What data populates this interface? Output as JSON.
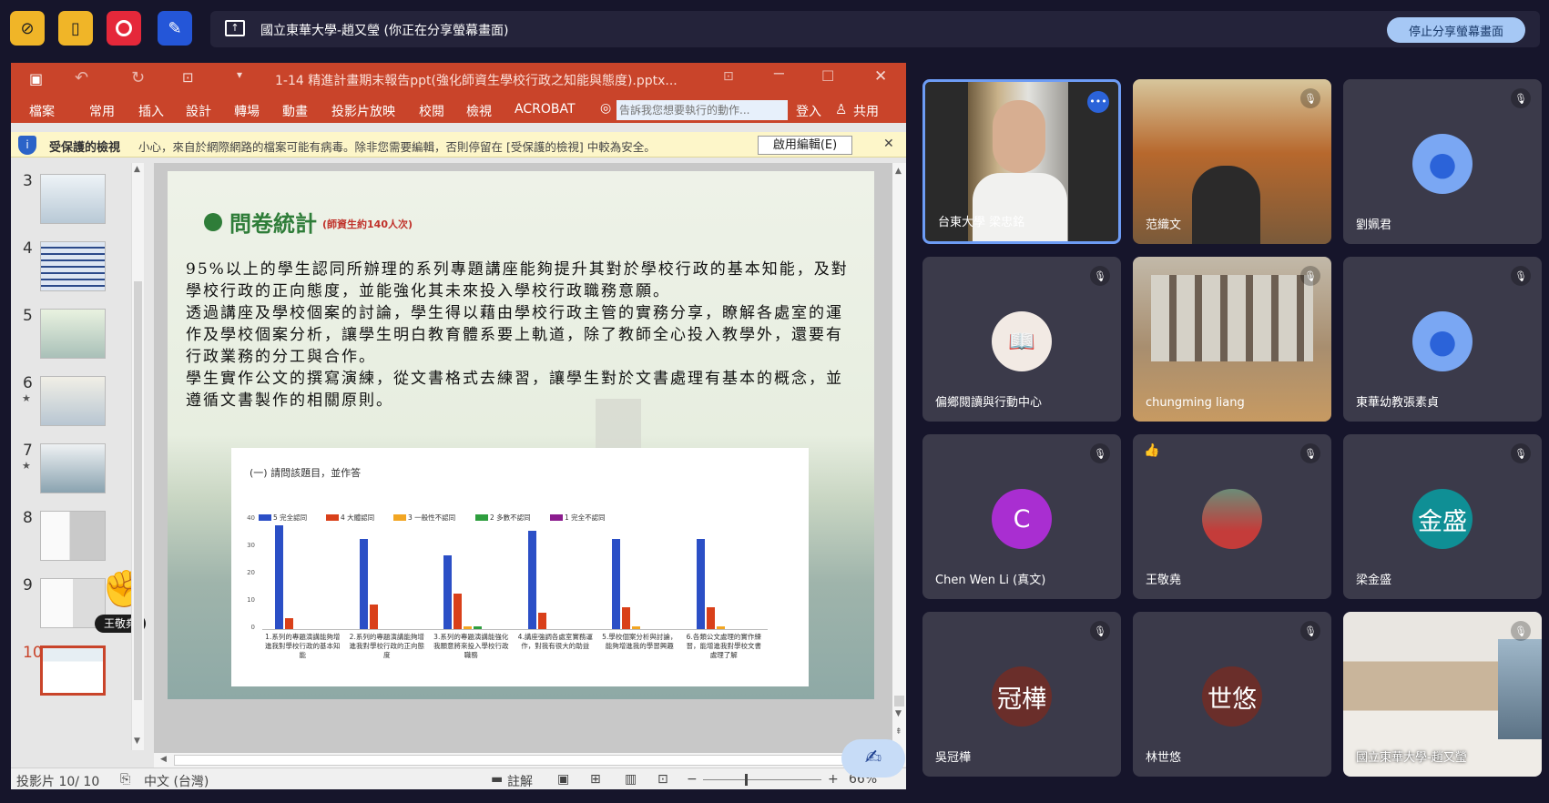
{
  "topbar": {
    "share_title": "國立東華大學-趙又瑩 (你正在分享螢幕畫面)",
    "stop_label": "停止分享螢幕畫面"
  },
  "colors": {
    "accent": "#2b63d9",
    "ppt_red": "#c9442a",
    "warn_bg": "#fdf6c9",
    "tile_bg": "#3b3a4a"
  },
  "ppt": {
    "filename": "1-14 精進計畫期末報告ppt(強化師資生學校行政之知能與態度).pptx...",
    "tabs": [
      "檔案",
      "常用",
      "插入",
      "設計",
      "轉場",
      "動畫",
      "投影片放映",
      "校閱",
      "檢視",
      "ACROBAT"
    ],
    "search_placeholder": "告訴我您想要執行的動作...",
    "login": "登入",
    "share": "共用",
    "warning_title": "受保護的檢視",
    "warning_text": "小心，來自於網際網路的檔案可能有病毒。除非您需要編輯，否則停留在 [受保護的檢視] 中較為安全。",
    "enable_edit": "啟用編輯(E)",
    "thumb_numbers": [
      "3",
      "4",
      "5",
      "6",
      "7",
      "8",
      "9",
      "10"
    ],
    "hand_label": "王敬堯",
    "status": {
      "slide": "投影片 10/ 10",
      "lang": "中文 (台灣)",
      "notes": "註解",
      "zoom": "66%"
    }
  },
  "slide": {
    "title": "問卷統計",
    "title_sub": "(師資生約140人次)",
    "paragraphs": [
      "95%以上的學生認同所辦理的系列專題講座能夠提升其對於學校行政的基本知能，及對學校行政的正向態度，並能強化其未來投入學校行政職務意願。",
      "透過講座及學校個案的討論，學生得以藉由學校行政主管的實務分享，瞭解各處室的運作及學校個案分析，讓學生明白教育體系要上軌道，除了教師全心投入教學外，還要有行政業務的分工與合作。",
      "學生實作公文的撰寫演練，從文書格式去練習，讓學生對於文書處理有基本的概念，並遵循文書製作的相關原則。"
    ]
  },
  "chart_data": {
    "type": "bar",
    "title": "(一) 請問該題目，並作答",
    "ylim": [
      0,
      40
    ],
    "yticks": [
      "40",
      "30",
      "20",
      "10",
      "0"
    ],
    "series": [
      {
        "name": "5 完全認同",
        "color": "#2b4fc6",
        "values": [
          38,
          33,
          27,
          36,
          33,
          33
        ]
      },
      {
        "name": "4 大體認同",
        "color": "#d9401a",
        "values": [
          4,
          9,
          13,
          6,
          8,
          8
        ]
      },
      {
        "name": "3 一般性不認同",
        "color": "#f2a623",
        "values": [
          0,
          0,
          1,
          0,
          1,
          1
        ]
      },
      {
        "name": "2 多數不認同",
        "color": "#2e9e3e",
        "values": [
          0,
          0,
          1,
          0,
          0,
          0
        ]
      },
      {
        "name": "1 完全不認同",
        "color": "#8b1c8e",
        "values": [
          0,
          0,
          0,
          0,
          0,
          0
        ]
      }
    ],
    "categories": [
      "1.系列的專題演講能夠增進我對學校行政的基本知能",
      "2.系列的專題演講能夠增進我對學校行政的正向態度",
      "3.系列的專題演講能強化我願意將來投入學校行政職務",
      "4.講座強調各處室實務運作，對我有很大的助益",
      "5.學校個案分析與討論，能夠增進我的學習興趣",
      "6.各類公文處理的實作練習，能增進我對學校文書處理了解"
    ]
  },
  "participants": [
    {
      "name": "台東大學 梁忠銘",
      "type": "video-speaker"
    },
    {
      "name": "范織文",
      "type": "video"
    },
    {
      "name": "劉姵君",
      "type": "avatar",
      "initial": "",
      "color": "#7aa7f3"
    },
    {
      "name": "偏鄉閱讀與行動中心",
      "type": "logo"
    },
    {
      "name": "chungming liang",
      "type": "video"
    },
    {
      "name": "東華幼教張素貞",
      "type": "avatar",
      "initial": "",
      "color": "#7aa7f3"
    },
    {
      "name": "Chen Wen Li (真文)",
      "type": "avatar",
      "initial": "C",
      "color": "#a92ed1"
    },
    {
      "name": "王敬堯",
      "type": "photo"
    },
    {
      "name": "梁金盛",
      "type": "avatar",
      "initial": "金盛",
      "color": "#0f8f95"
    },
    {
      "name": "吳冠樺",
      "type": "avatar",
      "initial": "冠樺",
      "color": "#6a2e2a"
    },
    {
      "name": "林世悠",
      "type": "avatar",
      "initial": "世悠",
      "color": "#6a2e2a"
    },
    {
      "name": "國立東華大學-趙又瑩",
      "type": "video"
    }
  ]
}
